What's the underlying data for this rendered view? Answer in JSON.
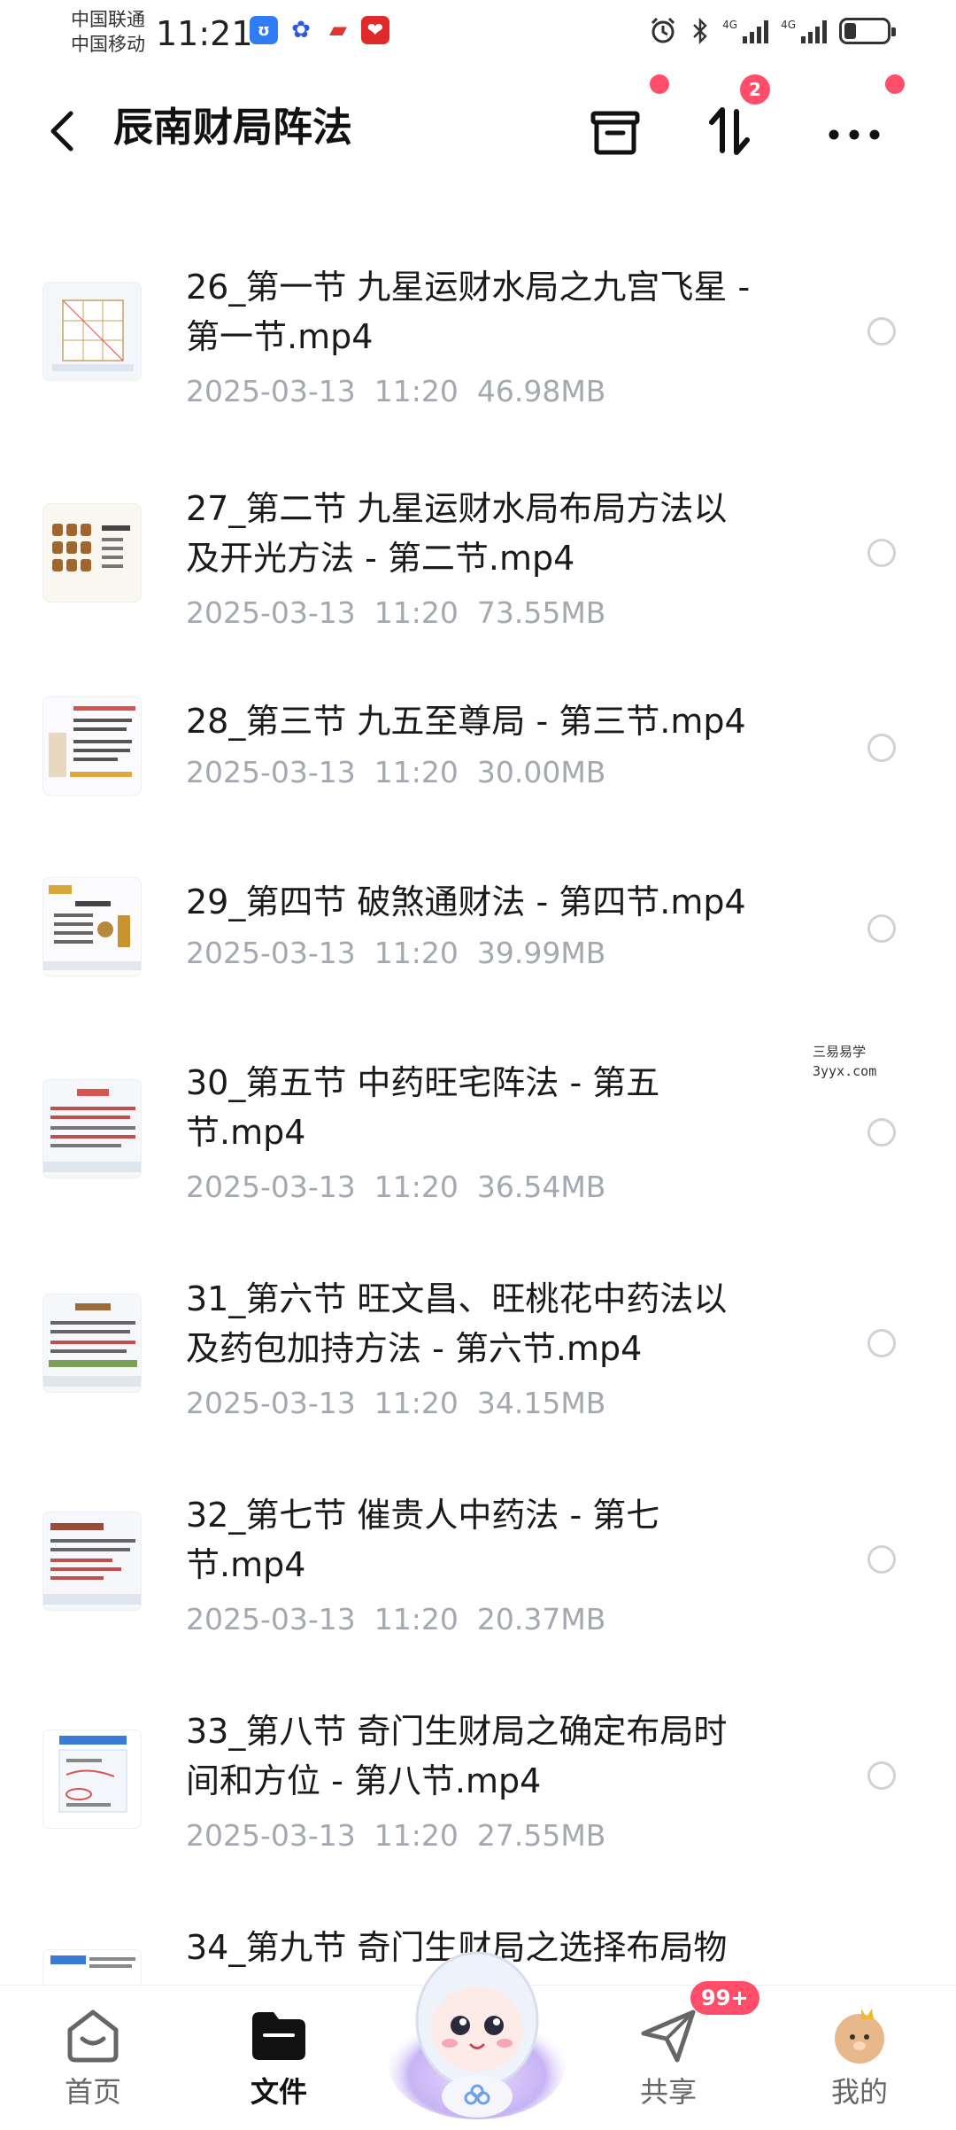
{
  "status_bar": {
    "carrier_1": "中国联通",
    "carrier_2": "中国移动",
    "time": "11:21",
    "signal_1": "4G",
    "signal_2": "4G"
  },
  "header": {
    "title": "辰南财局阵法",
    "transfer_badge": "2"
  },
  "files": [
    {
      "name": "26_第一节 九星运财水局之九宫飞星 -\n第一节.mp4",
      "date": "2025-03-13",
      "time": "11:20",
      "size": "46.98MB"
    },
    {
      "name": "27_第二节 九星运财水局布局方法以\n及开光方法 - 第二节.mp4",
      "date": "2025-03-13",
      "time": "11:20",
      "size": "73.55MB"
    },
    {
      "name": "28_第三节 九五至尊局 - 第三节.mp4",
      "date": "2025-03-13",
      "time": "11:20",
      "size": "30.00MB"
    },
    {
      "name": "29_第四节 破煞通财法 - 第四节.mp4",
      "date": "2025-03-13",
      "time": "11:20",
      "size": "39.99MB"
    },
    {
      "name": "30_第五节 中药旺宅阵法 - 第五\n节.mp4",
      "date": "2025-03-13",
      "time": "11:20",
      "size": "36.54MB"
    },
    {
      "name": "31_第六节 旺文昌、旺桃花中药法以\n及药包加持方法 - 第六节.mp4",
      "date": "2025-03-13",
      "time": "11:20",
      "size": "34.15MB"
    },
    {
      "name": "32_第七节 催贵人中药法 - 第七\n节.mp4",
      "date": "2025-03-13",
      "time": "11:20",
      "size": "20.37MB"
    },
    {
      "name": "33_第八节 奇门生财局之确定布局时\n间和方位 - 第八节.mp4",
      "date": "2025-03-13",
      "time": "11:20",
      "size": "27.55MB"
    },
    {
      "name": "34_第九节 奇门生财局之选择布局物",
      "date": "",
      "time": "",
      "size": ""
    }
  ],
  "watermark": {
    "line1": "三易易学",
    "line2": "3yyx.com"
  },
  "bottom_nav": {
    "home": "首页",
    "files": "文件",
    "share": "共享",
    "mine": "我的",
    "share_badge": "99+"
  },
  "colors": {
    "accent_red": "#ff4d6a",
    "meta_gray": "#a3a8b1"
  }
}
